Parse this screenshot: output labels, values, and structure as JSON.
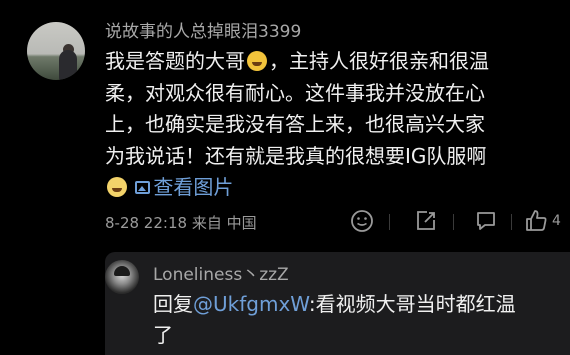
{
  "comment": {
    "username": "说故事的人总掉眼泪3399",
    "lines": [
      "我是答题的大哥",
      "，主持人很好很亲和很温",
      "柔，对观众很有耐心。这件事我并没放在心",
      "上，也确实是我没有答上来，也很高兴大家",
      "为我说话！还有就是我真的很想要IG队服啊"
    ],
    "view_image_label": "查看图片",
    "date": "8-28 22:18",
    "location": "来自 中国",
    "like_count": "4"
  },
  "reply": {
    "username": "Loneliness丶zzZ",
    "prefix": "回复",
    "mention": "@UkfgmxW",
    "line1": ":看视频大哥当时都红温",
    "line2": "了"
  },
  "icons": [
    "smile-emoji-icon",
    "crying-emoji-icon",
    "image-icon",
    "react-icon",
    "share-icon",
    "comment-icon",
    "like-icon"
  ],
  "colors": {
    "link": "#6f9fd8",
    "background": "#000000",
    "reply_bg": "#1c1c1e"
  }
}
